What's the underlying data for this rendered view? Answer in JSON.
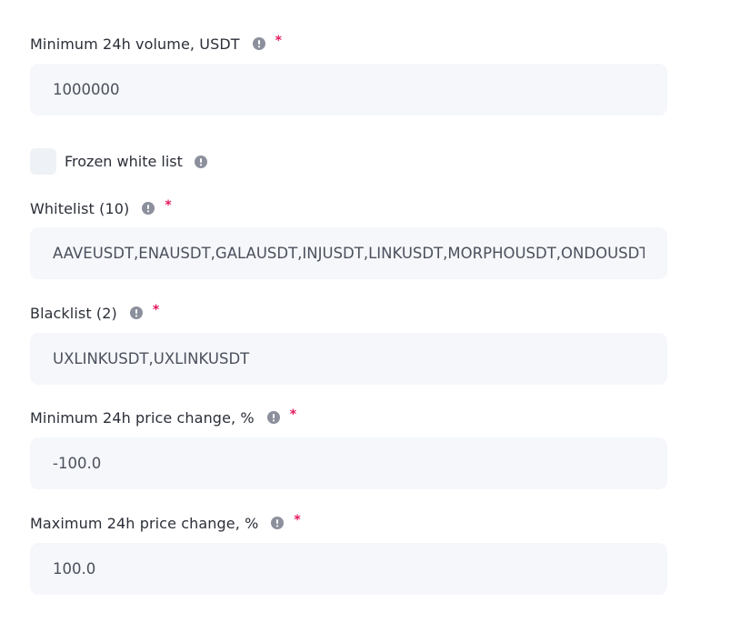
{
  "fields": [
    {
      "label": "Minimum 24h volume, USDT",
      "required": "*",
      "value": "1000000"
    },
    {
      "label": "Whitelist (10)",
      "required": "*",
      "value": "AAVEUSDT,ENAUSDT,GALAUSDT,INJUSDT,LINKUSDT,MORPHOUSDT,ONDOUSDT"
    },
    {
      "label": "Blacklist (2)",
      "required": "*",
      "value": "UXLINKUSDT,UXLINKUSDT"
    },
    {
      "label": "Minimum 24h price change, %",
      "required": "*",
      "value": "-100.0"
    },
    {
      "label": "Maximum 24h price change, %",
      "required": "*",
      "value": "100.0"
    }
  ],
  "frozen_whitelist": {
    "label": "Frozen white list",
    "checked": false
  },
  "colors": {
    "required": "#e5195a",
    "field_bg": "#f5f7fa",
    "info_icon": "#8c909c"
  },
  "icons": {
    "info": "info-circle-icon"
  }
}
